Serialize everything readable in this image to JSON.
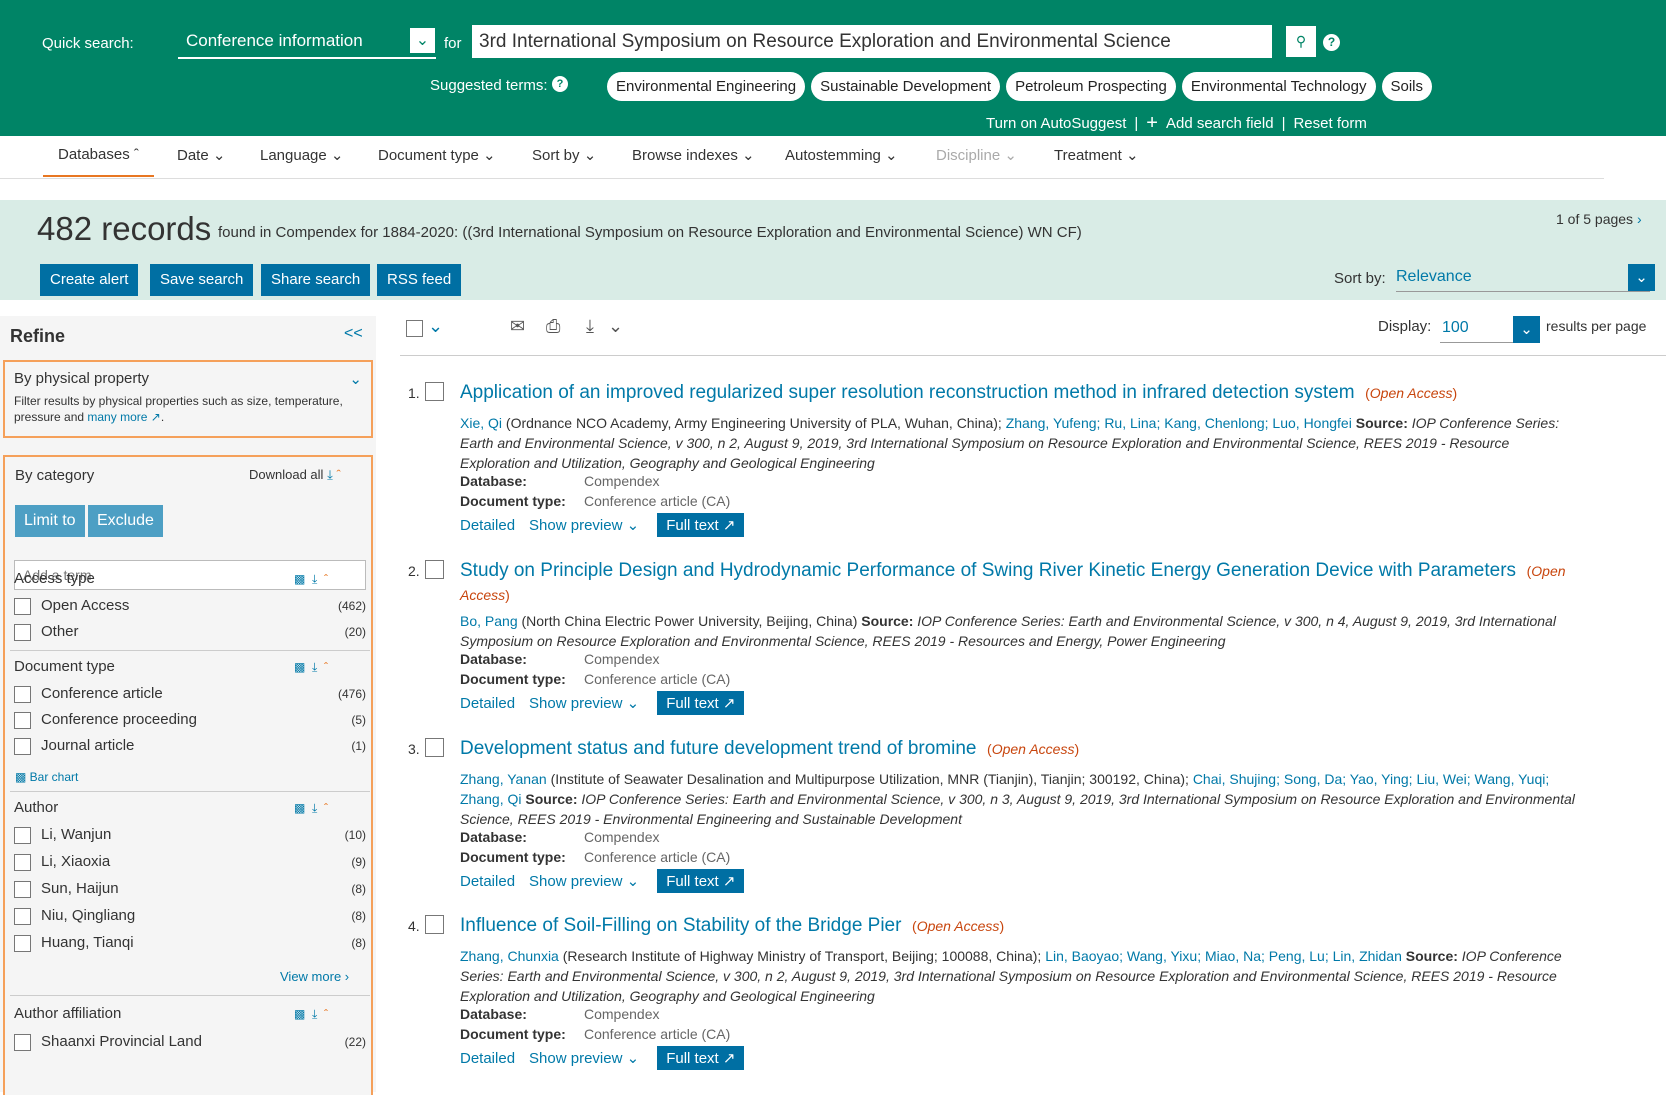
{
  "search": {
    "quick_label": "Quick search:",
    "field_value": "Conference information",
    "for_label": "for",
    "query": "3rd International Symposium on Resource Exploration and Environmental Science",
    "suggested_label": "Suggested terms:",
    "suggested": [
      "Environmental Engineering",
      "Sustainable Development",
      "Petroleum Prospecting",
      "Environmental Technology",
      "Soils"
    ],
    "autosuggest": "Turn on AutoSuggest",
    "add_field": "Add search field",
    "reset": "Reset form"
  },
  "nav": {
    "items": [
      "Databases",
      "Date",
      "Language",
      "Document type",
      "Sort by",
      "Browse indexes",
      "Autostemming",
      "Discipline",
      "Treatment"
    ]
  },
  "results": {
    "count": "482 records",
    "found": "found in Compendex for 1884-2020: ((3rd International Symposium on Resource Exploration and Environmental Science) WN CF)",
    "pages": "1 of 5 pages",
    "buttons": [
      "Create alert",
      "Save search",
      "Share search",
      "RSS feed"
    ],
    "sort_label": "Sort by:",
    "sort_value": "Relevance",
    "display_label": "Display:",
    "display_value": "100",
    "per_page": "results per page"
  },
  "sidebar": {
    "refine": "Refine",
    "collapse": "<<",
    "physical_title": "By physical property",
    "physical_desc": "Filter results by physical properties such as size, temperature, pressure and",
    "many_more": "many more",
    "category_title": "By category",
    "download_all": "Download all",
    "limit": "Limit to",
    "exclude": "Exclude",
    "add_term": "Add a term",
    "bar_chart": "Bar chart",
    "view_more": "View more",
    "facets": {
      "access": {
        "title": "Access type",
        "items": [
          {
            "label": "Open Access",
            "count": "(462)"
          },
          {
            "label": "Other",
            "count": "(20)"
          }
        ]
      },
      "doctype": {
        "title": "Document type",
        "items": [
          {
            "label": "Conference article",
            "count": "(476)"
          },
          {
            "label": "Conference proceeding",
            "count": "(5)"
          },
          {
            "label": "Journal article",
            "count": "(1)"
          }
        ]
      },
      "author": {
        "title": "Author",
        "items": [
          {
            "label": "Li, Wanjun",
            "count": "(10)"
          },
          {
            "label": "Li, Xiaoxia",
            "count": "(9)"
          },
          {
            "label": "Sun, Haijun",
            "count": "(8)"
          },
          {
            "label": "Niu, Qingliang",
            "count": "(8)"
          },
          {
            "label": "Huang, Tianqi",
            "count": "(8)"
          }
        ]
      },
      "affil": {
        "title": "Author affiliation",
        "items": [
          {
            "label": "Shaanxi Provincial Land",
            "count": "(22)"
          }
        ]
      }
    }
  },
  "labels": {
    "database": "Database:",
    "doctype": "Document type:",
    "detailed": "Detailed",
    "preview": "Show preview",
    "fulltext": "Full text",
    "open_access": "Open Access",
    "compendex": "Compendex",
    "conf_article": "Conference article (CA)",
    "source": "Source:"
  },
  "records": [
    {
      "num": "1.",
      "title": "Application of an improved regularized super resolution reconstruction method in infrared detection system",
      "a1": "Xie, Qi",
      "aff1": "(Ordnance NCO Academy, Army Engineering University of PLA, Wuhan, China);",
      "others": "Zhang, Yufeng; Ru, Lina; Kang, Chenlong; Luo, Hongfei",
      "src": "IOP Conference Series: Earth and Environmental Science, v 300, n 2, August 9, 2019, 3rd International Symposium on Resource Exploration and Environmental Science, REES 2019 - Resource Exploration and Utilization, Geography and Geological Engineering"
    },
    {
      "num": "2.",
      "title": "Study on Principle Design and Hydrodynamic Performance of Swing River Kinetic Energy Generation Device with Parameters",
      "a1": "Bo, Pang",
      "aff1": "(North China Electric Power University, Beijing, China)",
      "others": "",
      "src": "IOP Conference Series: Earth and Environmental Science, v 300, n 4, August 9, 2019, 3rd International Symposium on Resource Exploration and Environmental Science, REES 2019 - Resources and Energy, Power Engineering"
    },
    {
      "num": "3.",
      "title": "Development status and future development trend of bromine",
      "a1": "Zhang, Yanan",
      "aff1": "(Institute of Seawater Desalination and Multipurpose Utilization, MNR (Tianjin), Tianjin; 300192, China);",
      "others": "Chai, Shujing; Song, Da; Yao, Ying; Liu, Wei; Wang, Yuqi; Zhang, Qi",
      "src": "IOP Conference Series: Earth and Environmental Science, v 300, n 3, August 9, 2019, 3rd International Symposium on Resource Exploration and Environmental Science, REES 2019 - Environmental Engineering and Sustainable Development"
    },
    {
      "num": "4.",
      "title": "Influence of Soil-Filling on Stability of the Bridge Pier",
      "a1": "Zhang, Chunxia",
      "aff1": "(Research Institute of Highway Ministry of Transport, Beijing; 100088, China);",
      "others": "Lin, Baoyao; Wang, Yixu; Miao, Na; Peng, Lu; Lin, Zhidan",
      "src": "IOP Conference Series: Earth and Environmental Science, v 300, n 2, August 9, 2019, 3rd International Symposium on Resource Exploration and Environmental Science, REES 2019 - Resource Exploration and Utilization, Geography and Geological Engineering"
    }
  ]
}
